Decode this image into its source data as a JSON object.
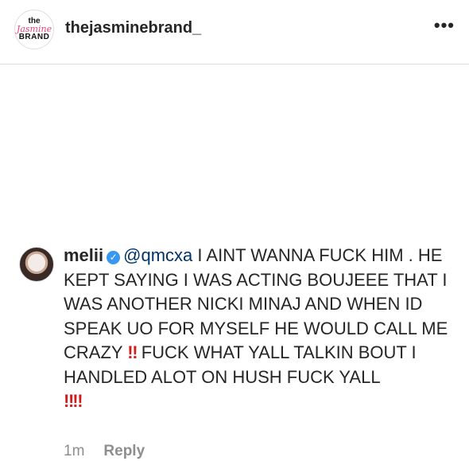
{
  "header": {
    "avatar_logo": {
      "line1": "the",
      "line2": "Jasmine",
      "line3": "BRAND"
    },
    "username": "thejasminebrand_",
    "more_label": "•••"
  },
  "comment": {
    "username": "melii",
    "verified_glyph": "✓",
    "mention": "@qmcxa",
    "text_part1": " I AINT WANNA FUCK HIM . HE KEPT SAYING I WAS ACTING BOUJEEE THAT I WAS ANOTHER NICKI MINAJ AND WHEN ID SPEAK UO FOR MYSELF HE WOULD CALL ME CRAZY ",
    "emoji1": "‼",
    "text_part2": " FUCK WHAT YALL TALKIN BOUT I HANDLED ALOT ON HUSH FUCK YALL ",
    "emoji2": "‼‼"
  },
  "meta": {
    "time": "1m",
    "reply_label": "Reply"
  },
  "colors": {
    "verified_blue": "#3897f0",
    "mention": "#003569",
    "emoji_red": "#d11a1a",
    "muted": "#8e8e8e"
  }
}
